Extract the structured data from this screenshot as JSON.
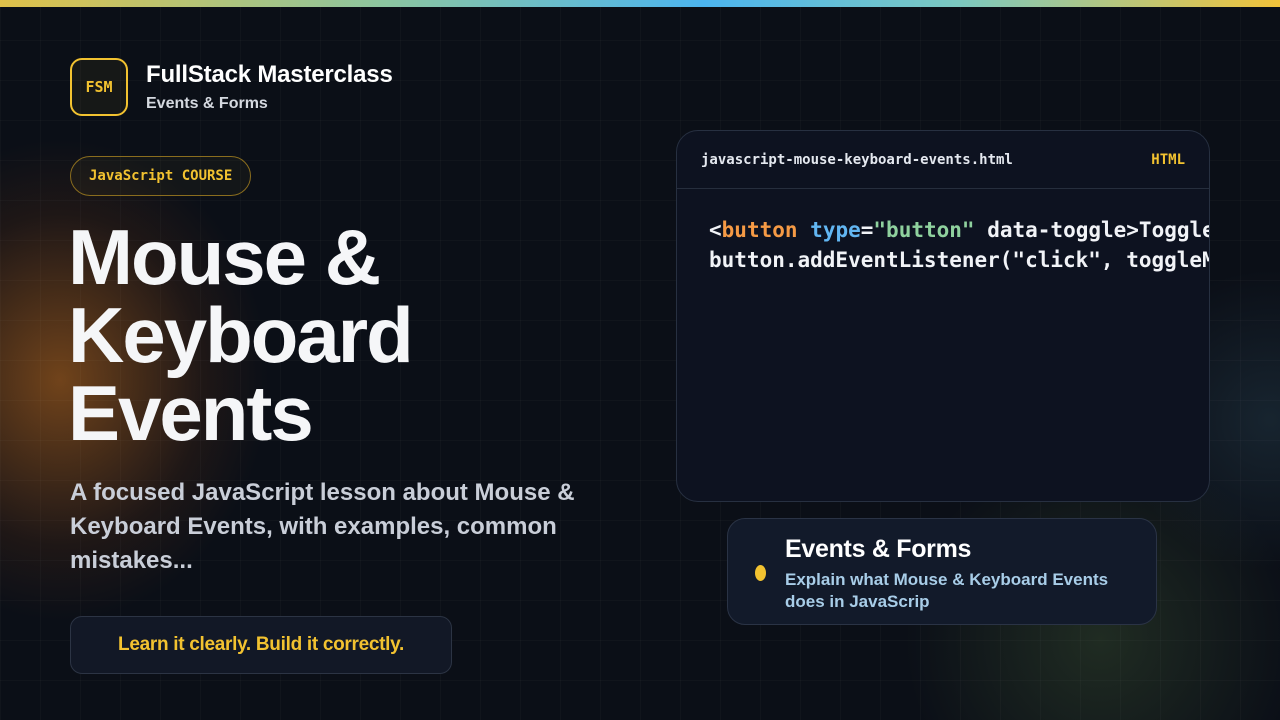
{
  "brand": {
    "logo_text": "FSM",
    "name": "FullStack Masterclass",
    "subtitle": "Events & Forms"
  },
  "badge": {
    "label": "JavaScript COURSE"
  },
  "hero": {
    "title_lines": [
      "Mouse &",
      "Keyboard",
      "Events"
    ],
    "description": "A focused JavaScript lesson about Mouse & Keyboard Events, with examples, common mistakes..."
  },
  "tagline": "Learn it clearly. Build it correctly.",
  "code_window": {
    "filename": "javascript-mouse-keyboard-events.html",
    "language": "HTML",
    "lines": [
      [
        {
          "t": "<",
          "c": "plain"
        },
        {
          "t": "button",
          "c": "kw"
        },
        {
          "t": " ",
          "c": "plain"
        },
        {
          "t": "type",
          "c": "attr"
        },
        {
          "t": "=",
          "c": "plain"
        },
        {
          "t": "\"button\"",
          "c": "str"
        },
        {
          "t": " data-toggle>Toggle menu</button>",
          "c": "plain"
        }
      ],
      [
        {
          "t": "button.addEventListener(\"click\", toggleMenu);",
          "c": "plain"
        }
      ]
    ]
  },
  "info_card": {
    "title": "Events & Forms",
    "text": "Explain what Mouse & Keyboard Events does in JavaScrip"
  },
  "colors": {
    "accent": "#f2c230",
    "background": "#0b0f17",
    "keyword": "#f59a45",
    "attribute": "#62b6f2",
    "string": "#8fd19e"
  }
}
